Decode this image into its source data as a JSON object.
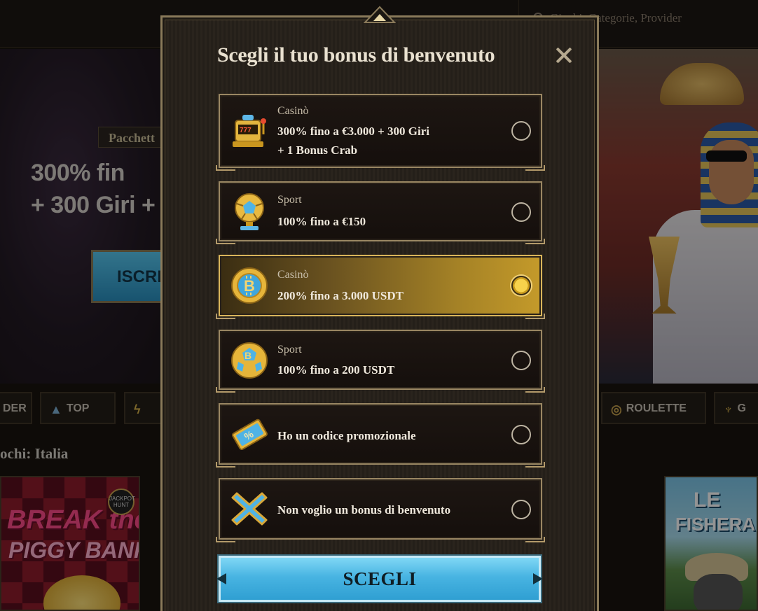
{
  "background": {
    "search_placeholder": "Giochi, Categorie, Provider",
    "banner_badge": "Pacchett",
    "banner_line1": "300% fin",
    "banner_line2": "+ 300 Giri +",
    "banner_button": "ISCRI",
    "categories": [
      {
        "label": "DER",
        "icon": "provider-icon"
      },
      {
        "label": "TOP",
        "icon": "pyramid-icon"
      },
      {
        "label": "",
        "icon": "lightning-icon"
      },
      {
        "label": "ROULETTE",
        "icon": "roulette-icon"
      },
      {
        "label": "G",
        "icon": "microphone-icon"
      }
    ],
    "games_title": "ochi: Italia",
    "game_left": {
      "title_line1": "BREAK the",
      "title_line2": "PIGGY BANK",
      "badge": "JACKPOT HUNT"
    },
    "game_right": {
      "title_line1": "LE",
      "title_line2": "FISHERA"
    }
  },
  "modal": {
    "title": "Scegli il tuo bonus di benvenuto",
    "options": [
      {
        "category": "Casinò",
        "line1": "300% fino a €3.000 + 300 Giri",
        "line2": "+ 1 Bonus Crab",
        "icon": "slot-machine-icon",
        "selected": false
      },
      {
        "category": "Sport",
        "line1": "100% fino a €150",
        "line2": "",
        "icon": "football-trophy-icon",
        "selected": false
      },
      {
        "category": "Casinò",
        "line1": "200% fino a 3.000 USDT",
        "line2": "",
        "icon": "bitcoin-coin-icon",
        "selected": true
      },
      {
        "category": "Sport",
        "line1": "100% fino a 200 USDT",
        "line2": "",
        "icon": "bitcoin-ball-icon",
        "selected": false
      },
      {
        "category": "",
        "line1": "Ho un codice promozionale",
        "line2": "",
        "icon": "promo-ticket-icon",
        "selected": false
      },
      {
        "category": "",
        "line1": "Non voglio un bonus di benvenuto",
        "line2": "",
        "icon": "cross-icon",
        "selected": false
      }
    ],
    "choose_label": "SCEGLI"
  },
  "colors": {
    "accent_blue": "#48b4e2",
    "gold": "#c49a2a",
    "frame": "#8a7a5a"
  }
}
